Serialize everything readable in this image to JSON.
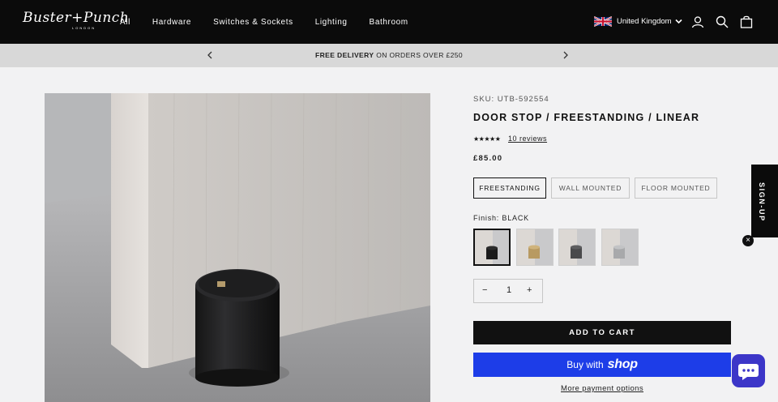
{
  "brand": {
    "logo_text": "Buster+Punch",
    "logo_sub": "LONDON"
  },
  "nav": {
    "items": [
      "All",
      "Hardware",
      "Switches & Sockets",
      "Lighting",
      "Bathroom"
    ]
  },
  "region": {
    "label": "United Kingdom"
  },
  "icons": {
    "account": "user-icon",
    "search": "search-icon",
    "cart": "bag-icon"
  },
  "promo": {
    "strong": "FREE DELIVERY",
    "rest": " ON ORDERS OVER £250"
  },
  "product": {
    "sku": "SKU: UTB-592554",
    "title": "DOOR STOP / FREESTANDING / LINEAR",
    "stars": "★★★★★",
    "reviews": "10 reviews",
    "price": "£85.00",
    "variants": [
      "FREESTANDING",
      "WALL MOUNTED",
      "FLOOR MOUNTED"
    ],
    "finish_label": "Finish: BLACK",
    "quantity": "1",
    "qty_minus": "−",
    "qty_plus": "+",
    "add_to_cart": "ADD TO CART",
    "buy_with": "Buy with",
    "shop_brand": "shop",
    "more_payment": "More payment options"
  },
  "signup": {
    "label": "SIGN-UP",
    "close": "×"
  },
  "colors": {
    "nav_bg": "#0b0b0b",
    "promo_bg": "#d8d8d8",
    "shop_pay": "#1d3de8",
    "chat": "#3c36c8"
  }
}
